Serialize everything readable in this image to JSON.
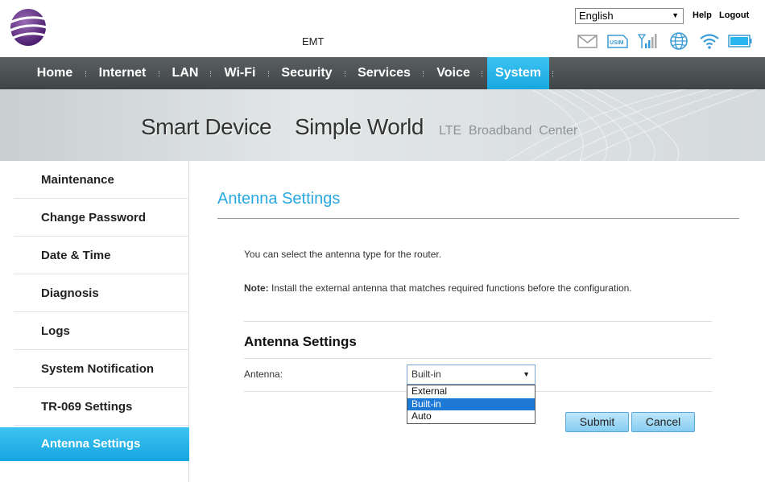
{
  "header": {
    "operator": "EMT",
    "language": "English",
    "help_label": "Help",
    "logout_label": "Logout",
    "status_icons": [
      "envelope-icon",
      "usim-icon",
      "signal-icon",
      "globe-icon",
      "wifi-icon",
      "battery-icon"
    ],
    "usim_text": "USIM"
  },
  "nav": {
    "items": [
      "Home",
      "Internet",
      "LAN",
      "Wi-Fi",
      "Security",
      "Services",
      "Voice",
      "System"
    ],
    "active": "System"
  },
  "banner": {
    "text1": "Smart Device",
    "text2": "Simple World",
    "text3": "LTE  Broadband  Center"
  },
  "sidebar": {
    "items": [
      "Maintenance",
      "Change Password",
      "Date & Time",
      "Diagnosis",
      "Logs",
      "System Notification",
      "TR-069 Settings",
      "Antenna Settings"
    ],
    "active": "Antenna Settings"
  },
  "main": {
    "title": "Antenna Settings",
    "description": "You can select the antenna type for the router.",
    "note_label": "Note:",
    "note_text": " Install the external antenna that matches required functions before the configuration.",
    "section_title": "Antenna Settings",
    "antenna_label": "Antenna:",
    "antenna_value": "Built-in",
    "antenna_options": [
      "External",
      "Built-in",
      "Auto"
    ],
    "submit_label": "Submit",
    "cancel_label": "Cancel"
  },
  "colors": {
    "accent": "#29a8e0",
    "nav_bg": "#4a4f51",
    "selected_option": "#1e78d6"
  }
}
